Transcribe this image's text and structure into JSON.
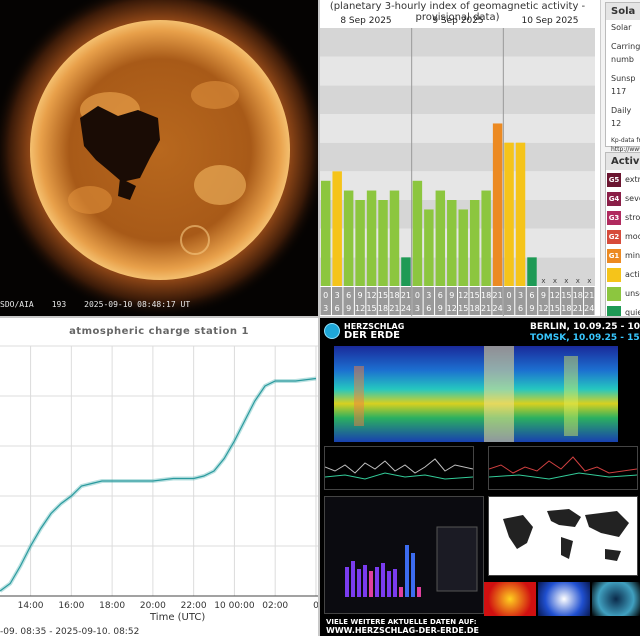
{
  "sun": {
    "instrument": "SDO/AIA",
    "channel": "193",
    "timestamp": "2025-09-10 08:48:17 UT"
  },
  "kp": {
    "title": "(planetary 3-hourly index of geomagnetic activity - provisional data)",
    "dates": [
      "8 Sep 2025",
      "9 Sep 2025",
      "10 Sep 2025"
    ],
    "hours": [
      "0",
      "3",
      "6",
      "9",
      "12",
      "15",
      "18",
      "21"
    ],
    "hour_ends": [
      "3",
      "6",
      "9",
      "12",
      "15",
      "18",
      "21",
      "24"
    ],
    "side_title": "Sola",
    "side_rows": [
      "Solar",
      "Carring",
      "numb",
      "Sunsp",
      "117",
      "Daily",
      "12",
      "Kp-data from",
      "http://www."
    ],
    "activity_title": "Activi",
    "levels": [
      {
        "code": "G5",
        "label": "extre",
        "color": "#6b1530"
      },
      {
        "code": "G4",
        "label": "seve",
        "color": "#8a1e47"
      },
      {
        "code": "G3",
        "label": "stron",
        "color": "#b02a5e"
      },
      {
        "code": "G2",
        "label": "mod",
        "color": "#d64a3a"
      },
      {
        "code": "G1",
        "label": "mino",
        "color": "#ec8a22"
      },
      {
        "code": "",
        "label": "activ",
        "color": "#f5c41a"
      },
      {
        "code": "",
        "label": "unse",
        "color": "#8cc63f"
      },
      {
        "code": "",
        "label": "quie",
        "color": "#1e9a55"
      }
    ]
  },
  "chart_data": [
    {
      "type": "bar",
      "title": "(planetary 3-hourly index of geomagnetic activity - provisional data)",
      "xlabel": "",
      "ylabel": "",
      "ylim": [
        0,
        9
      ],
      "categories": [
        "8 Sep 0-3",
        "8 Sep 3-6",
        "8 Sep 6-9",
        "8 Sep 9-12",
        "8 Sep 12-15",
        "8 Sep 15-18",
        "8 Sep 18-21",
        "8 Sep 21-24",
        "9 Sep 0-3",
        "9 Sep 3-6",
        "9 Sep 6-9",
        "9 Sep 9-12",
        "9 Sep 12-15",
        "9 Sep 15-18",
        "9 Sep 18-21",
        "9 Sep 21-24",
        "10 Sep 0-3",
        "10 Sep 3-6",
        "10 Sep 6-9"
      ],
      "values": [
        3.67,
        4.0,
        3.33,
        3.0,
        3.33,
        3.0,
        3.33,
        1.0,
        3.67,
        2.67,
        3.33,
        3.0,
        2.67,
        3.0,
        3.33,
        5.67,
        5.0,
        5.0,
        1.0
      ],
      "colors": [
        "#8cc63f",
        "#f5c41a",
        "#8cc63f",
        "#8cc63f",
        "#8cc63f",
        "#8cc63f",
        "#8cc63f",
        "#1e9a55",
        "#8cc63f",
        "#8cc63f",
        "#8cc63f",
        "#8cc63f",
        "#8cc63f",
        "#8cc63f",
        "#8cc63f",
        "#ec8a22",
        "#f5c41a",
        "#f5c41a",
        "#1e9a55"
      ]
    },
    {
      "type": "line",
      "title": "atmospheric charge station 1",
      "xlabel": "Time (UTC)",
      "ylabel": "",
      "x_ticks": [
        "14:00",
        "16:00",
        "18:00",
        "20:00",
        "22:00",
        "10 00:00",
        "02:00",
        "0"
      ],
      "x_hours": [
        14,
        16,
        18,
        20,
        22,
        24,
        26,
        28
      ],
      "xlim": [
        12.5,
        28.1
      ],
      "ylim": [
        0,
        1
      ],
      "series": [
        {
          "x": [
            12.5,
            13.0,
            13.5,
            14.0,
            14.5,
            15.0,
            15.5,
            16.0,
            16.5,
            17.0,
            17.5,
            18.0,
            19.0,
            20.0,
            21.0,
            22.0,
            22.5,
            23.0,
            23.5,
            24.0,
            24.5,
            25.0,
            25.5,
            26.0,
            27.0,
            28.0
          ],
          "y": [
            0.02,
            0.05,
            0.12,
            0.2,
            0.27,
            0.33,
            0.37,
            0.4,
            0.44,
            0.45,
            0.46,
            0.46,
            0.46,
            0.46,
            0.47,
            0.47,
            0.48,
            0.5,
            0.55,
            0.62,
            0.7,
            0.78,
            0.84,
            0.86,
            0.86,
            0.87
          ]
        }
      ]
    }
  ],
  "charge": {
    "title": "atmospheric charge station 1",
    "axis_title": "Time (UTC)",
    "range": "-09. 08:35 - 2025-09-10. 08:52"
  },
  "hde": {
    "brand_line1": "HERZSCHLAG",
    "brand_line2": "DER ERDE",
    "time_berlin": "BERLIN, 10.09.25 - 10:55",
    "time_tomsk": "TOMSK, 10.09.25 - 15:55",
    "footer1": "VIELE WEITERE AKTUELLE DATEN AUF:",
    "footer2": "WWW.HERZSCHLAG-DER-ERDE.DE"
  }
}
